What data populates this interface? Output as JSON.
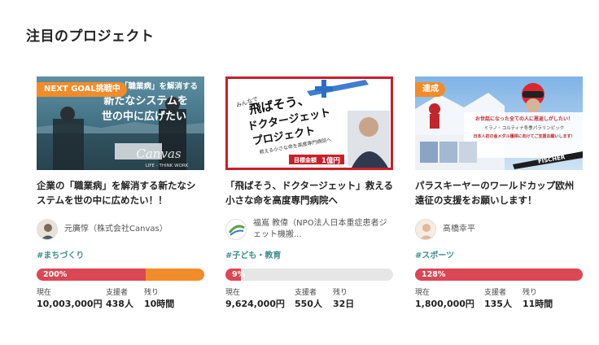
{
  "section": {
    "title": "注目のプロジェクト"
  },
  "labels": {
    "current": "現在",
    "supporters": "支援者",
    "remaining": "残り"
  },
  "colors": {
    "accent_red": "#dc4755",
    "accent_orange": "#f28c28",
    "tag_teal": "#3b8e8a"
  },
  "projects": [
    {
      "badge": "NEXT GOAL挑戦中",
      "thumb_text": [
        "「職業病」を解消する",
        "新たなシステムを",
        "世の中に広げたい"
      ],
      "thumb_logo": "Canvas",
      "thumb_sub": "LIFE - THINK WORK",
      "title": "企業の「職業病」を解消する新たなシステムを世の中に広めたい！！",
      "owner": "元廣惇（株式会社Canvas）",
      "tag": "#まちづくり",
      "percent_label": "200%",
      "progress": 2.0,
      "amount": "10,003,000円",
      "supporters": "438人",
      "remaining": "10時間"
    },
    {
      "badge": "",
      "thumb_text": [
        "みんなで",
        "飛ばそう、",
        "ドクタージェット",
        "プロジェクト",
        "救える小さな命を高度専門病院へ",
        "目標金額",
        "1億円"
      ],
      "title": "「飛ばそう、ドクタージェット」救える小さな命を高度専門病院へ",
      "owner": "福嶌 教偉（NPO法人日本重症患者ジェット機搬...",
      "tag": "#子ども・教育",
      "percent_label": "9%",
      "progress": 0.09,
      "amount": "9,624,000円",
      "supporters": "550人",
      "remaining": "32日"
    },
    {
      "badge": "達成",
      "thumb_text": [
        "お世話になった全ての人に恩返しがしたい！",
        "ミラノ・コルティナ冬季パラリンピック",
        "日本人初の金メダル獲得に向けてご支援お願いします！"
      ],
      "thumb_brand": "FISCHER",
      "title": "パラスキーヤーのワールドカップ欧州遠征の支援をお願いします！",
      "owner": "髙橋幸平",
      "tag": "#スポーツ",
      "percent_label": "128%",
      "progress": 1.28,
      "amount": "1,800,000円",
      "supporters": "135人",
      "remaining": "11時間"
    }
  ]
}
